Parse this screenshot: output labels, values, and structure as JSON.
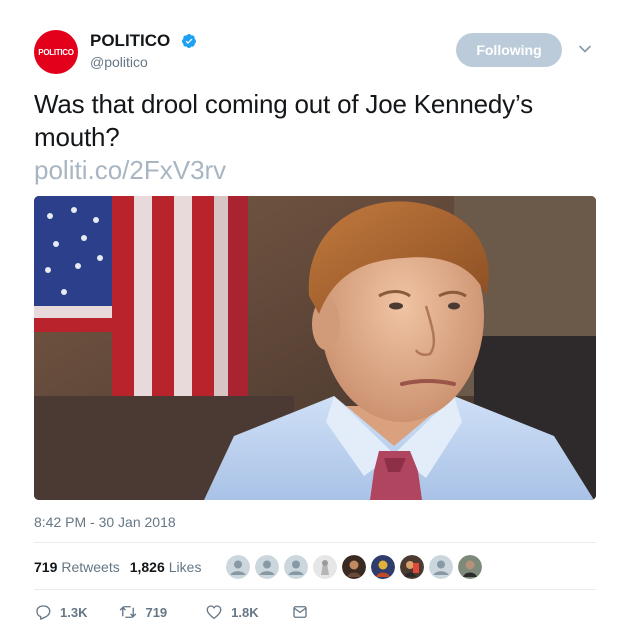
{
  "author": {
    "logo_text": "POLITICO",
    "display_name": "POLITICO",
    "handle": "@politico",
    "verified": true,
    "brand_color": "#e2001a"
  },
  "follow_button": {
    "label": "Following"
  },
  "tweet": {
    "text": "Was that drool coming out of Joe Kennedy’s mouth?",
    "link": "politi.co/2FxV3rv",
    "timestamp": "8:42 PM - 30 Jan 2018"
  },
  "stats": {
    "retweets_count": "719",
    "retweets_label": "Retweets",
    "likes_count": "1,826",
    "likes_label": "Likes"
  },
  "likers": [
    {
      "kind": "default-avatar-icon"
    },
    {
      "kind": "default-avatar-icon"
    },
    {
      "kind": "default-avatar-icon"
    },
    {
      "kind": "photo-avatar"
    },
    {
      "kind": "photo-avatar"
    },
    {
      "kind": "photo-avatar"
    },
    {
      "kind": "photo-avatar"
    },
    {
      "kind": "default-avatar-icon"
    },
    {
      "kind": "photo-avatar"
    }
  ],
  "actions": {
    "replies": "1.3K",
    "retweets": "719",
    "likes": "1.8K"
  },
  "icons": {
    "reply": "reply-icon",
    "retweet": "retweet-icon",
    "like": "heart-icon",
    "dm": "envelope-icon",
    "caret": "chevron-down-icon",
    "verified": "verified-badge-icon"
  },
  "colors": {
    "text": "#14171a",
    "secondary": "#657786",
    "link_faded": "#a8b6c3",
    "following_button": "#bbcbd9",
    "verified": "#1da1f2"
  }
}
